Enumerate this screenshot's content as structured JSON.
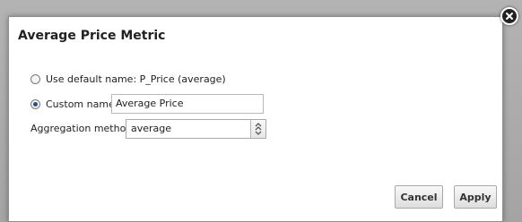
{
  "dialog": {
    "title": "Average Price Metric",
    "default_name_label": "Use default name: P_Price (average)",
    "custom_name_label": "Custom name",
    "custom_name_value": "Average Price",
    "aggregation_label": "Aggregation method:",
    "aggregation_value": "average",
    "selected_option": "custom",
    "cancel_label": "Cancel",
    "apply_label": "Apply"
  },
  "icons": {
    "close": "close-icon",
    "dropdown": "chevron-updown-icon"
  },
  "colors": {
    "radio_selected": "#2a4f86",
    "close_button": "#222222"
  }
}
